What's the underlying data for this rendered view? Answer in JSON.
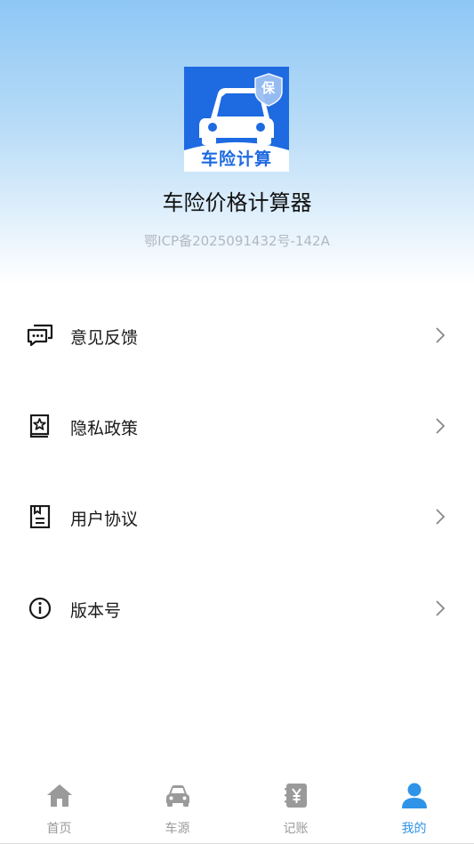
{
  "app": {
    "logo_text": "车险计算",
    "logo_badge": "保",
    "title": "车险价格计算器",
    "icp": "鄂ICP备2025091432号-142A"
  },
  "menu": [
    {
      "label": "意见反馈",
      "icon": "feedback-chat-icon"
    },
    {
      "label": "隐私政策",
      "icon": "privacy-book-icon"
    },
    {
      "label": "用户协议",
      "icon": "user-agreement-icon"
    },
    {
      "label": "版本号",
      "icon": "info-icon"
    }
  ],
  "tabs": [
    {
      "label": "首页",
      "icon": "home-icon",
      "active": false
    },
    {
      "label": "车源",
      "icon": "car-icon",
      "active": false
    },
    {
      "label": "记账",
      "icon": "ledger-icon",
      "active": false
    },
    {
      "label": "我的",
      "icon": "user-icon",
      "active": true
    }
  ],
  "colors": {
    "accent": "#2f93e8",
    "logo_blue": "#1e6ae1",
    "tab_inactive": "#9a9a9a"
  }
}
